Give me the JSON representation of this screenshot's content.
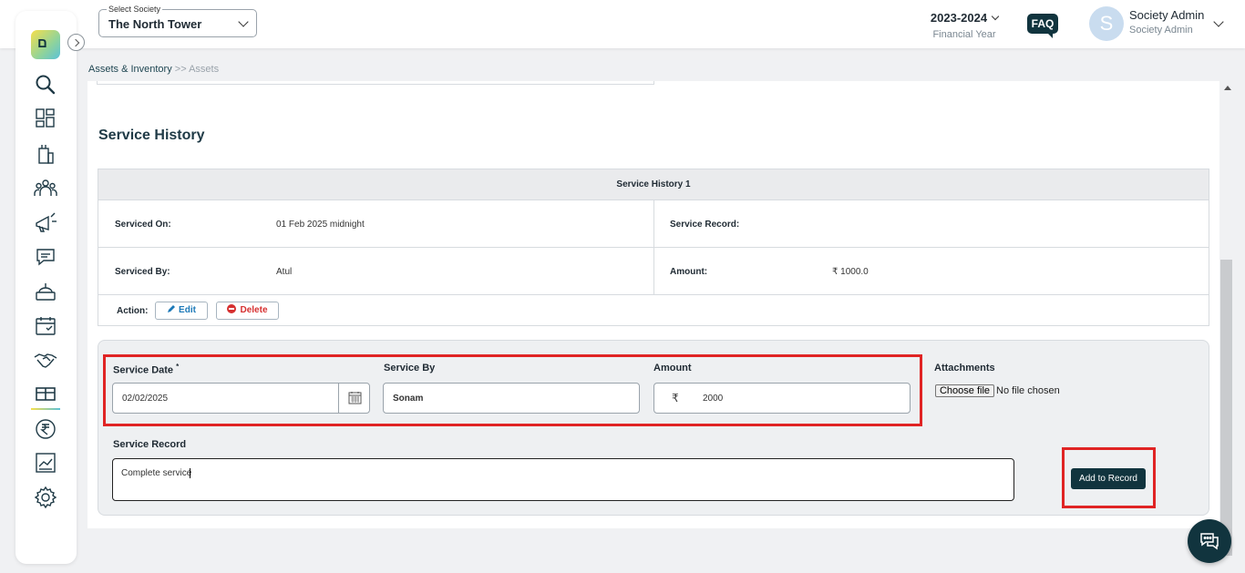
{
  "header": {
    "society_label": "Select Society",
    "society_value": "The North Tower",
    "financial_year": "2023-2024",
    "financial_year_label": "Financial Year",
    "faq_label": "FAQ",
    "avatar_letter": "S",
    "user_name": "Society Admin",
    "user_role": "Society Admin"
  },
  "sidebar": {
    "logo_text": "ຮ",
    "items": [
      {
        "name": "search-icon"
      },
      {
        "name": "dashboard-icon"
      },
      {
        "name": "building-icon"
      },
      {
        "name": "members-icon"
      },
      {
        "name": "announcement-icon"
      },
      {
        "name": "chat-icon"
      },
      {
        "name": "facility-icon"
      },
      {
        "name": "calendar-icon"
      },
      {
        "name": "handshake-icon"
      },
      {
        "name": "assets-icon",
        "active": true
      },
      {
        "name": "rupee-icon"
      },
      {
        "name": "reports-icon"
      },
      {
        "name": "settings-icon"
      }
    ]
  },
  "breadcrumb": {
    "parent": "Assets & Inventory",
    "sep": " >> ",
    "current": "Assets"
  },
  "service_history": {
    "title": "Service History",
    "entries": [
      {
        "header": "Service History 1",
        "serviced_on_label": "Serviced On:",
        "serviced_on": "01 Feb 2025 midnight",
        "service_record_label": "Service Record:",
        "service_record": "",
        "serviced_by_label": "Serviced By:",
        "serviced_by": "Atul",
        "amount_label": "Amount:",
        "amount": "₹ 1000.0",
        "action_label": "Action:",
        "edit_label": "Edit",
        "delete_label": "Delete"
      }
    ]
  },
  "form": {
    "service_date_label": "Service Date",
    "required_mark": "*",
    "service_date_value": "02/02/2025",
    "service_by_label": "Service By",
    "service_by_value": "Sonam",
    "amount_label": "Amount",
    "currency_symbol": "₹",
    "amount_value": "2000",
    "attachments_label": "Attachments",
    "choose_file_label": "Choose file",
    "no_file_text": "No file chosen",
    "service_record_label": "Service Record",
    "service_record_value": "Complete service",
    "add_button_label": "Add to Record"
  },
  "colors": {
    "brand_dark": "#11343e",
    "highlight_red": "#e02424",
    "delete_red": "#d63030",
    "edit_blue": "#1c79b8"
  }
}
